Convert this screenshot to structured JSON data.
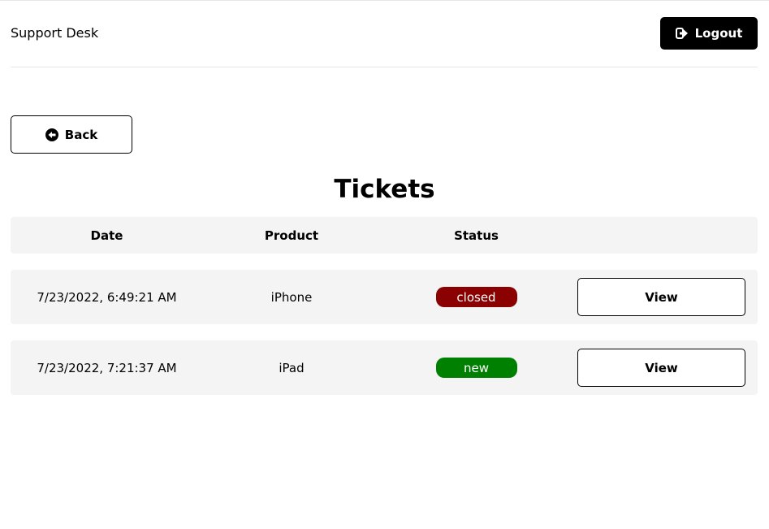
{
  "header": {
    "logo": "Support Desk",
    "logout_label": "Logout"
  },
  "back_label": "Back",
  "page_title": "Tickets",
  "table": {
    "columns": [
      "Date",
      "Product",
      "Status"
    ],
    "rows": [
      {
        "date": "7/23/2022, 6:49:21 AM",
        "product": "iPhone",
        "status": "closed",
        "status_color": "#8b0000",
        "action": "View"
      },
      {
        "date": "7/23/2022, 7:21:37 AM",
        "product": "iPad",
        "status": "new",
        "status_color": "#008000",
        "action": "View"
      }
    ]
  }
}
